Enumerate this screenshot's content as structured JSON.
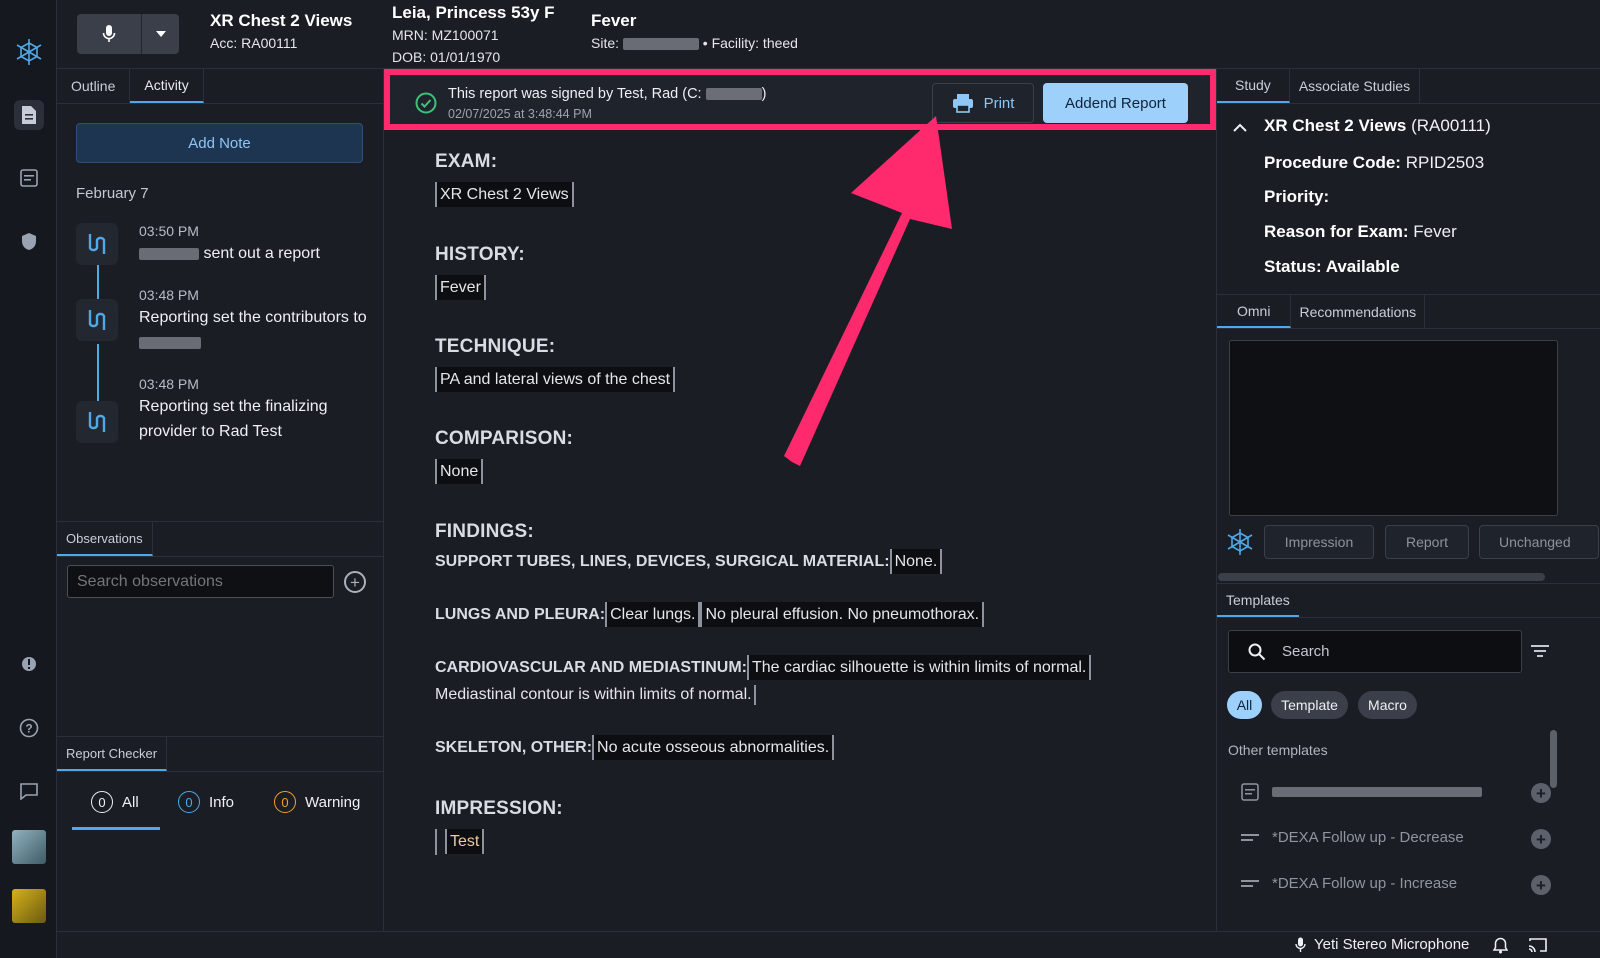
{
  "header": {
    "study_title": "XR Chest 2 Views",
    "accession": "Acc: RA00111",
    "patient_name": "Leia, Princess 53y F",
    "mrn": "MRN: MZ100071",
    "dob": "DOB: 01/01/1970",
    "reason": "Fever",
    "site_prefix": "Site:",
    "facility": "• Facility: theed"
  },
  "left_panel": {
    "tabs": [
      "Outline",
      "Activity"
    ],
    "add_note_label": "Add Note",
    "date_label": "February 7",
    "activity": [
      {
        "time": "03:50 PM",
        "text": "sent out a report"
      },
      {
        "time": "03:48 PM",
        "text": "Reporting set the contributors to"
      },
      {
        "time": "03:48 PM",
        "text": "Reporting set the finalizing provider to Rad Test"
      }
    ],
    "observations_tab": "Observations",
    "search_placeholder": "Search observations",
    "report_checker_tab": "Report Checker",
    "checker": [
      {
        "count": "0",
        "label": "All",
        "color": "#eef0f4"
      },
      {
        "count": "0",
        "label": "Info",
        "color": "#4fa8e8"
      },
      {
        "count": "0",
        "label": "Warning",
        "color": "#f0a030"
      }
    ]
  },
  "sign_bar": {
    "message": "This report was signed by Test, Rad (C:",
    "message_end": ")",
    "timestamp": "02/07/2025 at 3:48:44 PM",
    "print_label": "Print",
    "addend_label": "Addend Report"
  },
  "report": {
    "exam_head": "EXAM:",
    "exam": "XR Chest 2 Views",
    "history_head": "HISTORY:",
    "history": "Fever",
    "technique_head": "TECHNIQUE:",
    "technique": "PA and lateral views of the chest",
    "comparison_head": "COMPARISON:",
    "comparison": "None",
    "findings_head": "FINDINGS:",
    "support_label": "SUPPORT TUBES, LINES, DEVICES, SURGICAL MATERIAL:",
    "support_value": "None.",
    "lungs_label": "LUNGS AND PLEURA:",
    "lungs_value_1": "Clear lungs.",
    "lungs_value_2": "No pleural effusion. No pneumothorax.",
    "cardio_label": "CARDIOVASCULAR AND MEDIASTINUM:",
    "cardio_value_1": "The cardiac silhouette is within limits of normal.",
    "cardio_value_2": "Mediastinal contour is within limits of normal.",
    "skeleton_label": "SKELETON, OTHER:",
    "skeleton_value": "No acute osseous abnormalities.",
    "impression_head": "IMPRESSION:",
    "impression": "Test"
  },
  "right_panel": {
    "tabs": [
      "Study",
      "Associate Studies"
    ],
    "study_title": "XR Chest 2 Views",
    "study_acc": "(RA00111)",
    "procedure_label": "Procedure Code:",
    "procedure_value": "RPID2503",
    "priority_label": "Priority:",
    "reason_label": "Reason for Exam:",
    "reason_value": "Fever",
    "status_label": "Status: Available",
    "omni_tabs": [
      "Omni",
      "Recommendations"
    ],
    "chips": [
      "Impression",
      "Report",
      "Unchanged"
    ],
    "templates_tab": "Templates",
    "search_label": "Search",
    "filters": [
      "All",
      "Template",
      "Macro"
    ],
    "other_templates": "Other templates",
    "templates": [
      "*DEXA Follow up - Decrease",
      "*DEXA Follow up - Increase"
    ]
  },
  "status_bar": {
    "microphone": "Yeti Stereo Microphone"
  },
  "colors": {
    "accent": "#4fa8e8",
    "highlight": "#ff2a6d",
    "primary_button": "#9dd0fb",
    "success": "#3ec27a"
  }
}
